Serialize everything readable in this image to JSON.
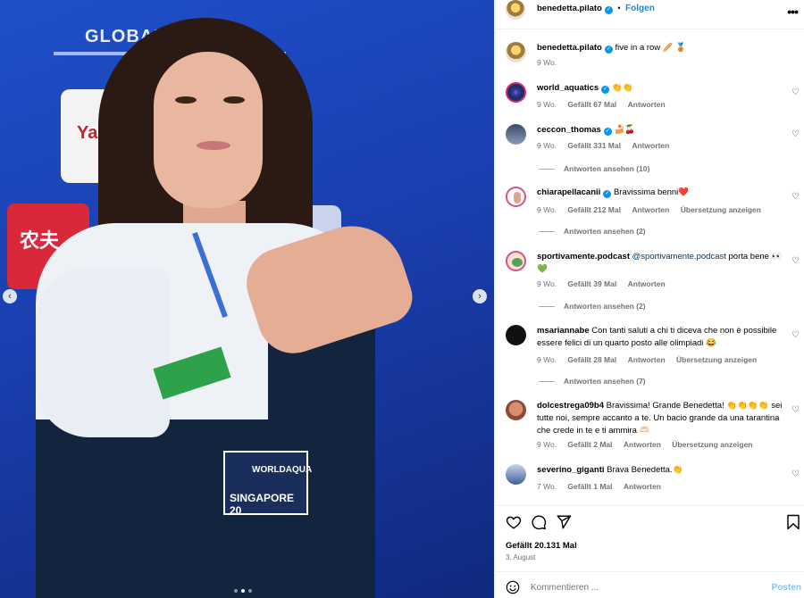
{
  "photo": {
    "prev_icon": "chevron-left-icon",
    "next_icon": "chevron-right-icon",
    "carousel": {
      "total": 3,
      "active": 2
    },
    "signage": {
      "logo": "GLOBAL",
      "sponsor_white": "Ya",
      "sponsor_red": "农夫",
      "badge_top": "WORLDAQUA",
      "badge_bottom": "SINGAPORE 20"
    }
  },
  "header": {
    "username": "benedetta.pilato",
    "follow_label": "Folgen",
    "more_icon": "more-horizontal-icon"
  },
  "caption": {
    "username": "benedetta.pilato",
    "text": "five in a row 🥖 🥉",
    "time": "9 Wo."
  },
  "comments": [
    {
      "username": "world_aquatics",
      "verified": true,
      "text": "👏👏",
      "time": "9 Wo.",
      "likes": "Gefällt 67 Mal",
      "reply": "Antworten"
    },
    {
      "username": "ceccon_thomas",
      "verified": true,
      "text": "🍰🍒",
      "time": "9 Wo.",
      "likes": "Gefällt 331 Mal",
      "reply": "Antworten",
      "view_replies": "Antworten ansehen (10)"
    },
    {
      "username": "chiarapellacanii",
      "verified": true,
      "text": "Bravissima benni❤️",
      "time": "9 Wo.",
      "likes": "Gefällt 212 Mal",
      "reply": "Antworten",
      "translate": "Übersetzung anzeigen",
      "view_replies": "Antworten ansehen (2)"
    },
    {
      "username": "sportivamente.podcast",
      "verified": false,
      "mention": "@sportivamente.podcast",
      "text": " porta bene 👀💚",
      "time": "9 Wo.",
      "likes": "Gefällt 39 Mal",
      "reply": "Antworten",
      "view_replies": "Antworten ansehen (2)"
    },
    {
      "username": "msariannabe",
      "verified": false,
      "text": "Con tanti saluti a chi ti diceva che non è possibile essere felici di un quarto posto alle olimpiadi 😂",
      "time": "9 Wo.",
      "likes": "Gefällt 28 Mal",
      "reply": "Antworten",
      "translate": "Übersetzung anzeigen",
      "view_replies": "Antworten ansehen (7)"
    },
    {
      "username": "dolcestrega09b4",
      "verified": false,
      "text": "Bravissima! Grande Benedetta! 👏👏👏👏 sei tutte noi, sempre accanto a te. Un bacio grande da una tarantina che crede in te e ti ammira 🫶🏻",
      "time": "9 Wo.",
      "likes": "Gefällt 2 Mal",
      "reply": "Antworten",
      "translate": "Übersetzung anzeigen"
    },
    {
      "username": "severino_giganti",
      "verified": false,
      "text": "Brava Benedetta.👏",
      "time": "7 Wo.",
      "likes": "Gefällt 1 Mal",
      "reply": "Antworten"
    }
  ],
  "actions": {
    "like_icon": "heart-icon",
    "comment_icon": "comment-icon",
    "share_icon": "paper-plane-icon",
    "save_icon": "bookmark-icon",
    "likes_text": "Gefällt 20.131 Mal",
    "date": "3. August"
  },
  "composer": {
    "placeholder": "Kommentieren ...",
    "post_label": "Posten",
    "emoji_icon": "smiley-icon"
  },
  "colors": {
    "accent": "#0095f6",
    "muted": "#737373",
    "post_disabled": "#87c1f7"
  }
}
